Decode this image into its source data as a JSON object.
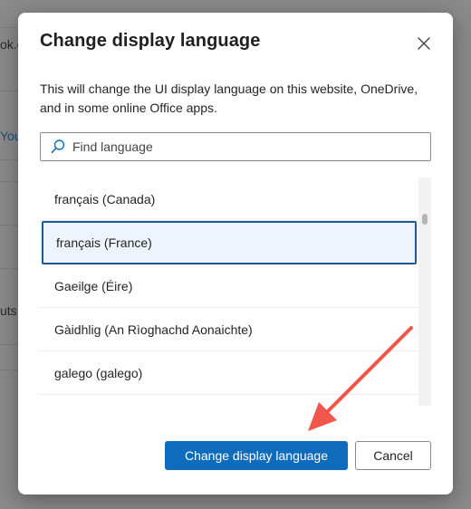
{
  "background": {
    "fragments": [
      "ok.c",
      "You",
      "uts"
    ]
  },
  "dialog": {
    "title": "Change display language",
    "close_icon": "close-icon",
    "description": "This will change the UI display language on this website, OneDrive, and in some online Office apps.",
    "search": {
      "placeholder": "Find language",
      "value": "",
      "icon": "search-icon"
    },
    "languages": [
      {
        "label": "français (Canada)",
        "selected": false
      },
      {
        "label": "français (France)",
        "selected": true
      },
      {
        "label": "Gaeilge (Éire)",
        "selected": false
      },
      {
        "label": "Gàidhlig (An Rìoghachd Aonaichte)",
        "selected": false
      },
      {
        "label": "galego (galego)",
        "selected": false
      }
    ],
    "buttons": {
      "primary_label": "Change display language",
      "cancel_label": "Cancel"
    }
  },
  "colors": {
    "primary": "#0f6cbd",
    "selected_border": "#1c5a96",
    "selected_bg": "#eef4fb",
    "annotation": "#f0564a"
  }
}
